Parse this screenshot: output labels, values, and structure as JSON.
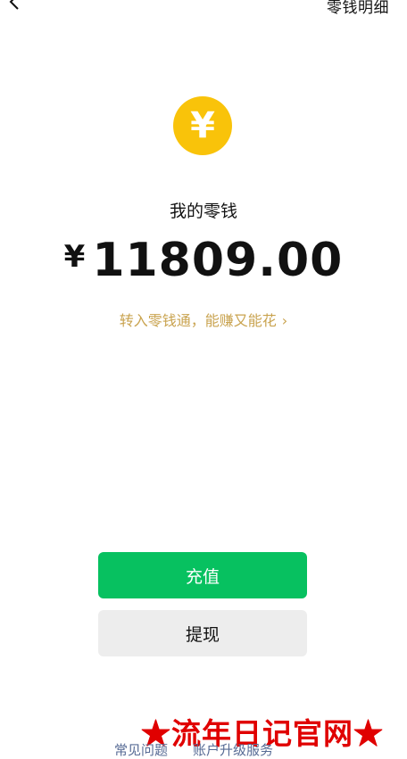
{
  "header": {
    "back_icon": "chevron-left-icon",
    "detail_link": "零钱明细"
  },
  "wallet": {
    "coin_symbol": "¥",
    "title": "我的零钱",
    "currency": "¥",
    "balance": "11809.00",
    "promo_text": "转入零钱通，能赚又能花",
    "promo_chevron": "›"
  },
  "actions": {
    "recharge_label": "充值",
    "withdraw_label": "提现"
  },
  "footer": {
    "faq_label": "常见问题",
    "upgrade_label": "账户升级服务"
  },
  "watermark": {
    "text": "★流年日记官网★"
  },
  "colors": {
    "coin": "#f9c30a",
    "primary_button": "#07c160",
    "secondary_button": "#ededed",
    "promo_text": "#c9a34f",
    "footer_link": "#576b95",
    "watermark": "#e00000"
  }
}
